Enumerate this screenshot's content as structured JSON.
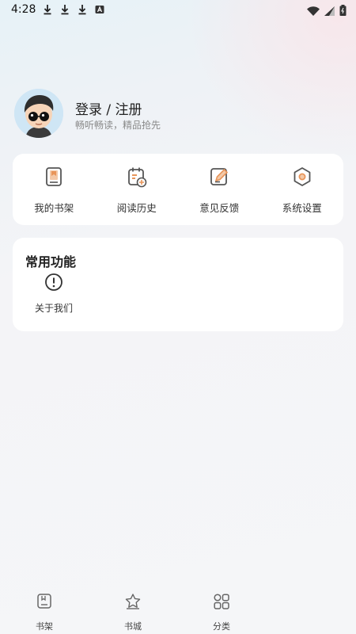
{
  "status_bar": {
    "time": "4:28"
  },
  "profile": {
    "title": "登录 / 注册",
    "subtitle": "畅听畅读，精品抢先"
  },
  "quick_menu": [
    {
      "label": "我的书架",
      "icon": "bookshelf-icon"
    },
    {
      "label": "阅读历史",
      "icon": "history-icon"
    },
    {
      "label": "意见反馈",
      "icon": "feedback-icon"
    },
    {
      "label": "系统设置",
      "icon": "settings-icon"
    }
  ],
  "common": {
    "title": "常用功能",
    "items": [
      {
        "label": "关于我们",
        "icon": "info-icon"
      }
    ]
  },
  "tabbar": [
    {
      "label": "书架",
      "icon": "bookshelf-tab-icon"
    },
    {
      "label": "书城",
      "icon": "bookstore-tab-icon"
    },
    {
      "label": "分类",
      "icon": "category-tab-icon"
    }
  ],
  "colors": {
    "accent": "#e8955a",
    "icon_stroke": "#555555",
    "card": "#ffffff"
  }
}
